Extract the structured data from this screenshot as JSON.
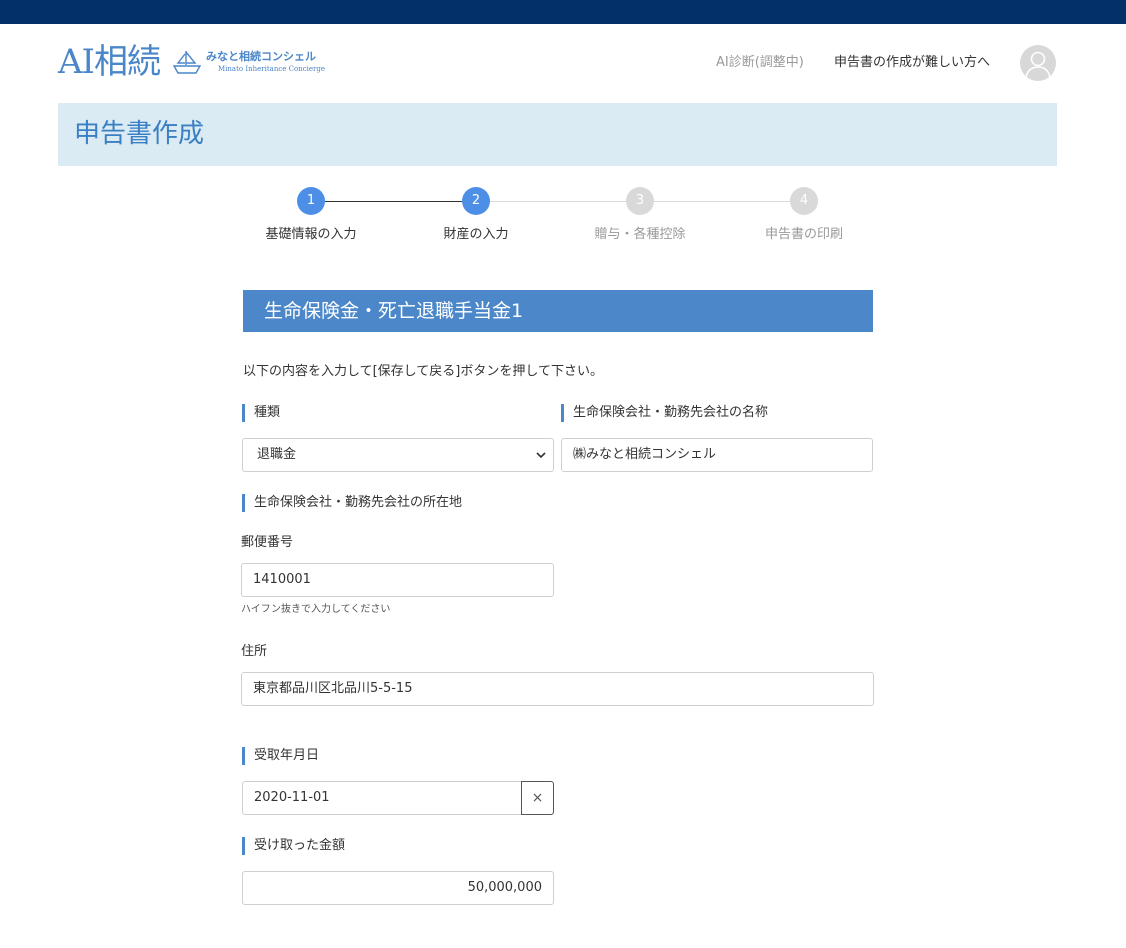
{
  "header": {
    "logo_main": "AI相続",
    "logo_sub_jp": "みなと相続コンシェル",
    "logo_sub_en": "Minato Inheritance Concierge",
    "nav_diagnosis": "AI診断(調整中)",
    "nav_help": "申告書の作成が難しい方へ"
  },
  "page": {
    "title": "申告書作成"
  },
  "stepper": {
    "current": 2,
    "steps": [
      {
        "number": "1",
        "label": "基礎情報の入力"
      },
      {
        "number": "2",
        "label": "財産の入力"
      },
      {
        "number": "3",
        "label": "贈与・各種控除"
      },
      {
        "number": "4",
        "label": "申告書の印刷"
      }
    ]
  },
  "form": {
    "section_title": "生命保険金・死亡退職手当金1",
    "instruction": "以下の内容を入力して[保存して戻る]ボタンを押して下さい。",
    "type_label": "種類",
    "type_value": "退職金",
    "company_name_label": "生命保険会社・勤務先会社の名称",
    "company_name_value": "㈱みなと相続コンシェル",
    "company_address_label": "生命保険会社・勤務先会社の所在地",
    "postal_label": "郵便番号",
    "postal_value": "1410001",
    "postal_help": "ハイフン抜きで入力してください",
    "address_label": "住所",
    "address_value": "東京都品川区北品川5-5-15",
    "receipt_date_label": "受取年月日",
    "receipt_date_value": "2020-11-01",
    "clear_label": "×",
    "amount_label": "受け取った金額",
    "amount_value": "50,000,000"
  },
  "colors": {
    "topbar": "#04306a",
    "brand": "#4a86c8",
    "banner_bg": "#daebf3",
    "section_bg": "#4c88c9",
    "step_active": "#4d8fe6",
    "step_inactive": "#d9d9d9"
  }
}
